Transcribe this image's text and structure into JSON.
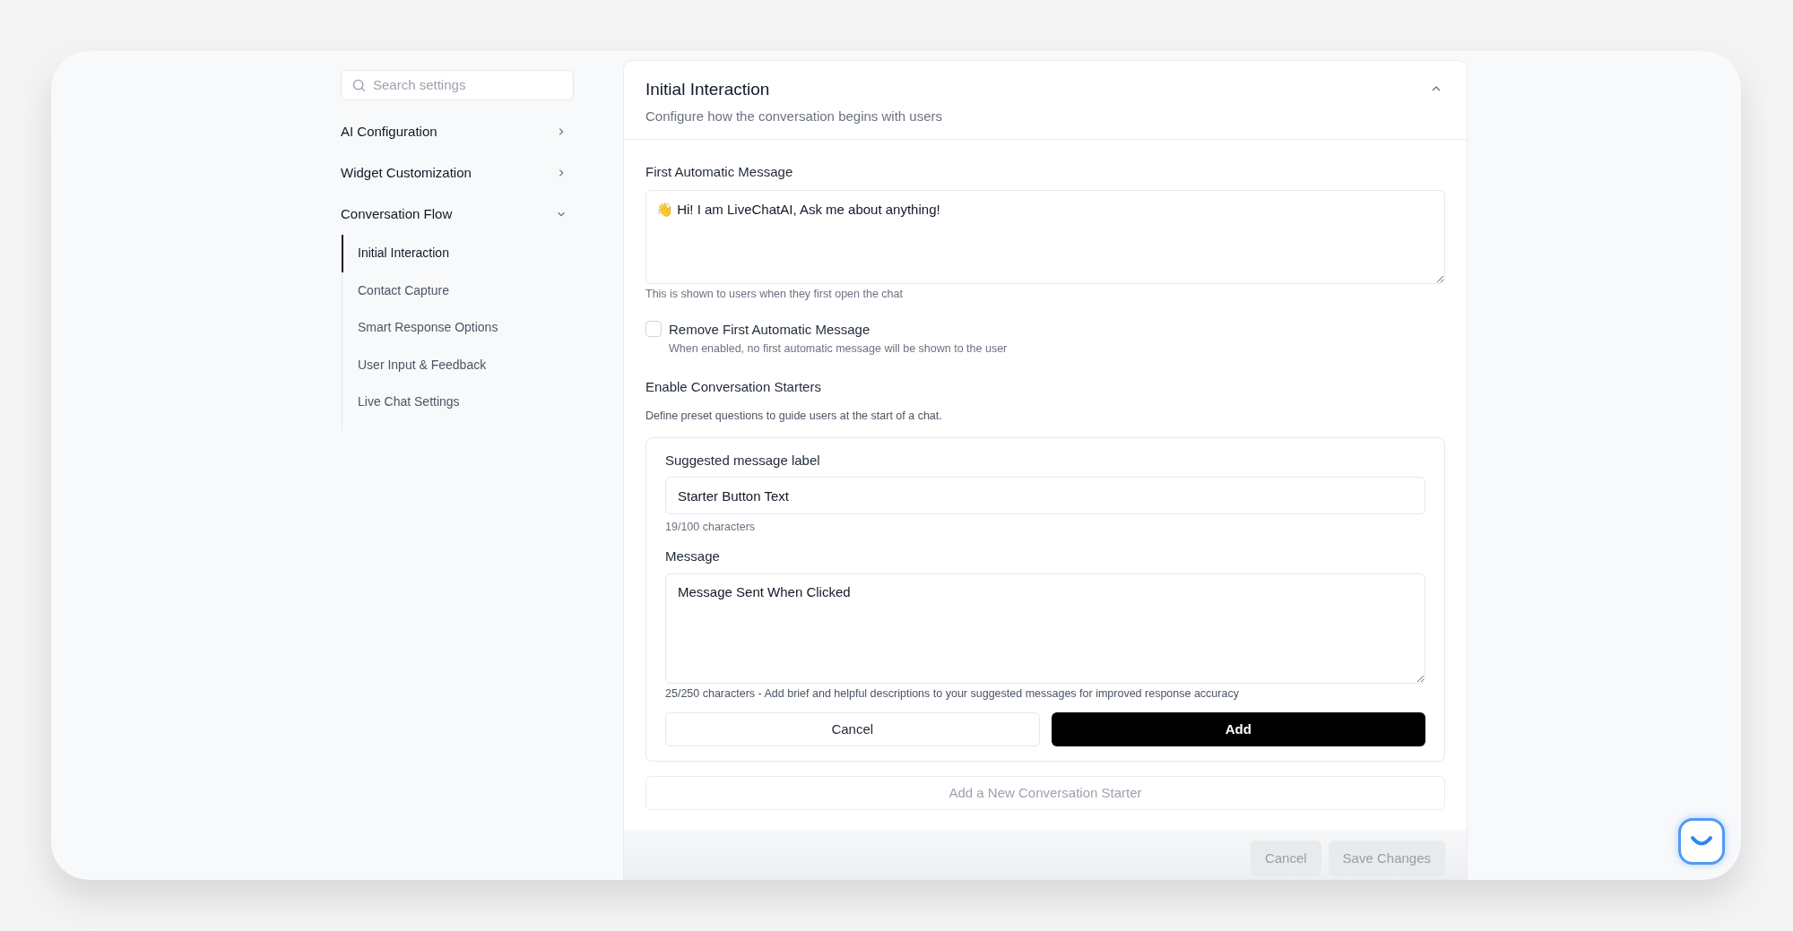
{
  "sidebar": {
    "search": {
      "placeholder": "Search settings"
    },
    "items": [
      {
        "label": "AI Configuration",
        "expanded": false
      },
      {
        "label": "Widget Customization",
        "expanded": false
      },
      {
        "label": "Conversation Flow",
        "expanded": true,
        "children": [
          {
            "label": "Initial Interaction",
            "selected": true
          },
          {
            "label": "Contact Capture",
            "selected": false
          },
          {
            "label": "Smart Response Options",
            "selected": false
          },
          {
            "label": "User Input & Feedback",
            "selected": false
          },
          {
            "label": "Live Chat Settings",
            "selected": false
          }
        ]
      }
    ]
  },
  "panel": {
    "title": "Initial Interaction",
    "subtitle": "Configure how the conversation begins with users",
    "expanded": true,
    "first_message": {
      "label": "First Automatic Message",
      "value": "👋 Hi! I am LiveChatAI, Ask me about anything!",
      "help": "This is shown to users when they first open the chat"
    },
    "remove_first": {
      "label": "Remove First Automatic Message",
      "description": "When enabled, no first automatic message will be shown to the user",
      "checked": false
    },
    "starters": {
      "title": "Enable Conversation Starters",
      "description": "Define preset questions to guide users at the start of a chat.",
      "label_field": {
        "label": "Suggested message label",
        "value": "Starter Button Text",
        "counter": "19/100 characters"
      },
      "message_field": {
        "label": "Message",
        "value": "Message Sent When Clicked",
        "help": "25/250 characters - Add brief and helpful descriptions to your suggested messages for improved response accuracy"
      },
      "cancel": "Cancel",
      "add": "Add"
    },
    "add_starter": "Add a New Conversation Starter",
    "footer": [
      {
        "label": "Cancel",
        "disabled": true
      },
      {
        "label": "Save Changes",
        "disabled": true
      }
    ]
  }
}
